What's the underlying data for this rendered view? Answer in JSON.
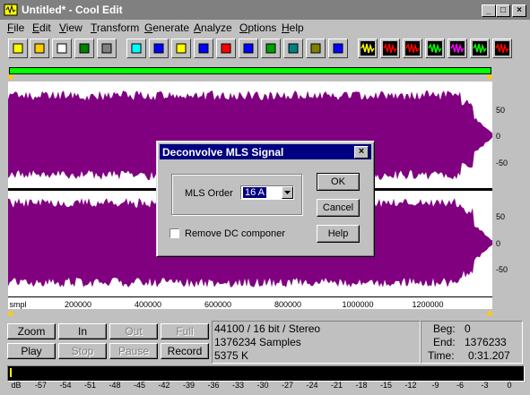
{
  "window": {
    "title": "Untitled* - Cool Edit",
    "controls": [
      "_",
      "□",
      "×"
    ]
  },
  "menu": [
    {
      "label": "File",
      "u": "F",
      "rest": "ile"
    },
    {
      "label": "Edit",
      "u": "E",
      "rest": "dit"
    },
    {
      "label": "View",
      "u": "V",
      "rest": "iew"
    },
    {
      "label": "Transform",
      "u": "T",
      "rest": "ransform"
    },
    {
      "label": "Generate",
      "u": "G",
      "rest": "enerate"
    },
    {
      "label": "Analyze",
      "u": "A",
      "rest": "nalyze"
    },
    {
      "label": "Options",
      "u": "O",
      "rest": "ptions"
    },
    {
      "label": "Help",
      "u": "H",
      "rest": "elp"
    }
  ],
  "toolbar": {
    "tools": [
      {
        "name": "new-file-icon",
        "color": "#ffff00"
      },
      {
        "name": "open-folder-icon",
        "color": "#ffcc00"
      },
      {
        "name": "save-disk-icon",
        "color": "#ffffff"
      },
      {
        "name": "save-selection-icon",
        "color": "#008000"
      },
      {
        "name": "headphones-icon",
        "color": "#808080"
      },
      {
        "name": "ear-icon",
        "color": "#00ffff"
      },
      {
        "name": "pitch-icon",
        "color": "#0000ff"
      },
      {
        "name": "amplify-icon",
        "color": "#ffff00"
      },
      {
        "name": "noise-gun-icon",
        "color": "#0000ff"
      },
      {
        "name": "envelope-icon",
        "color": "#ff0000"
      },
      {
        "name": "stretch-icon",
        "color": "#0000ff"
      },
      {
        "name": "bug-icon",
        "color": "#00a000"
      },
      {
        "name": "echo-icon",
        "color": "#008080"
      },
      {
        "name": "reverb-icon",
        "color": "#808000"
      },
      {
        "name": "spectrum-icon",
        "color": "#0000ff"
      },
      {
        "name": "edit-pencil-icon",
        "color": "#ffff00"
      },
      {
        "name": "waveform-red-icon",
        "color": "#ff0000"
      },
      {
        "name": "delete-wave-icon",
        "color": "#ff0000"
      },
      {
        "name": "wave-tone-icon",
        "color": "#00ff00"
      },
      {
        "name": "wave-edit-icon",
        "color": "#ff00ff"
      },
      {
        "name": "mix-down-icon",
        "color": "#00ff00"
      },
      {
        "name": "mix-split-icon",
        "color": "#ff0000"
      }
    ]
  },
  "waveform": {
    "color": "#800080",
    "background": "#ffffff",
    "y_labels_top": [
      "50",
      "0",
      "-50"
    ],
    "y_labels_bottom": [
      "50",
      "0",
      "-50"
    ],
    "x_unit": "smpl",
    "x_labels": [
      "200000",
      "400000",
      "600000",
      "800000",
      "1000000",
      "1200000"
    ]
  },
  "dialog": {
    "title": "Deconvolve MLS Signal",
    "mls_order_label": "MLS Order",
    "mls_order_value": "16 A",
    "remove_dc_label": "Remove DC componer",
    "remove_dc_checked": false,
    "ok_label": "OK",
    "cancel_label": "Cancel",
    "help_label": "Help"
  },
  "controls": {
    "buttons": [
      {
        "label": "Zoom",
        "enabled": true
      },
      {
        "label": "In",
        "enabled": true
      },
      {
        "label": "Out",
        "enabled": false
      },
      {
        "label": "Full",
        "enabled": false
      },
      {
        "label": "Play",
        "enabled": true
      },
      {
        "label": "Stop",
        "enabled": false
      },
      {
        "label": "Pause",
        "enabled": false
      },
      {
        "label": "Record",
        "enabled": true
      }
    ]
  },
  "status": {
    "format": "44100 / 16 bit / Stereo",
    "samples": "1376234 Samples",
    "size": "5375 K",
    "beg_label": "Beg:",
    "beg_value": "0",
    "end_label": "End:",
    "end_value": "1376233",
    "time_label": "Time:",
    "time_value": "0:31.207"
  },
  "meter": {
    "labels": [
      "dB",
      "-57",
      "-54",
      "-51",
      "-48",
      "-45",
      "-42",
      "-39",
      "-36",
      "-33",
      "-30",
      "-27",
      "-24",
      "-21",
      "-18",
      "-15",
      "-12",
      "-9",
      "-6",
      "-3",
      "0"
    ]
  }
}
